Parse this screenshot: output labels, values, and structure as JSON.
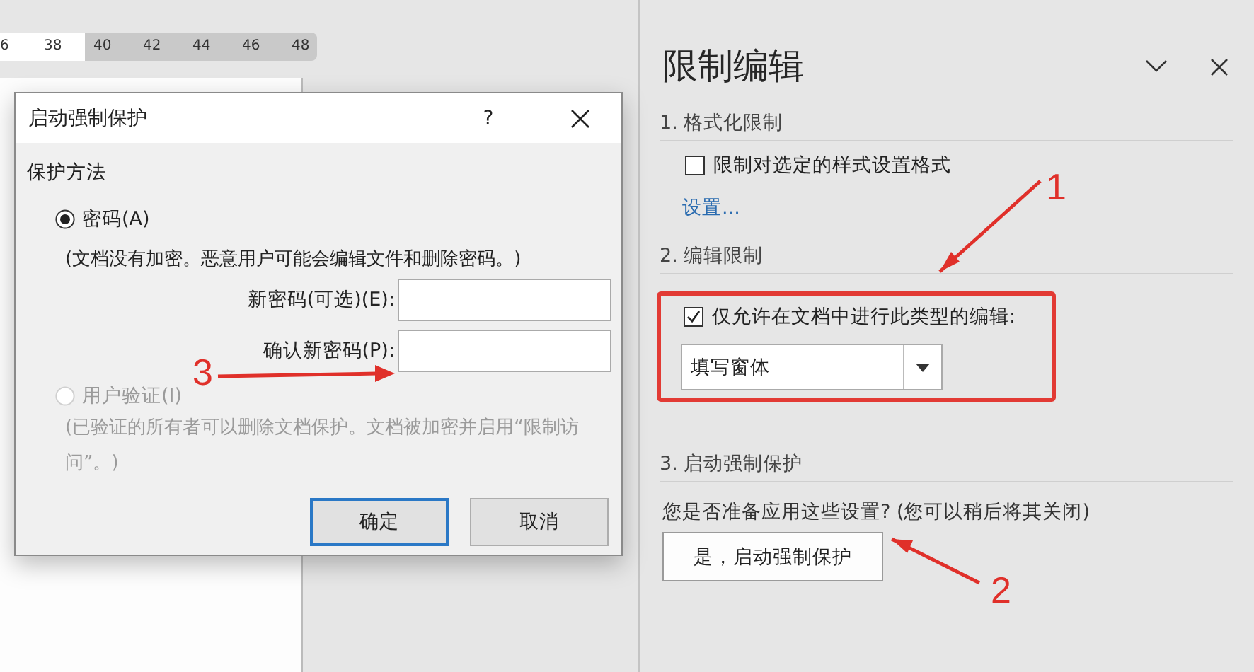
{
  "ruler": {
    "ticks": [
      "6",
      "38",
      "40",
      "42",
      "44",
      "46",
      "48"
    ]
  },
  "dialog": {
    "title": "启动强制保护",
    "help": "?",
    "section": "保护方法",
    "options": [
      {
        "label": "密码(A)",
        "selected": true,
        "disabled": false,
        "note": "(文档没有加密。恶意用户可能会编辑文件和删除密码。)"
      },
      {
        "label": "用户验证(I)",
        "selected": false,
        "disabled": true,
        "note": "(已验证的所有者可以删除文档保护。文档被加密并启用“限制访问”。)"
      }
    ],
    "fields": [
      {
        "label": "新密码(可选)(E):"
      },
      {
        "label": "确认新密码(P):"
      }
    ],
    "buttons": [
      {
        "label": "确定",
        "default": true
      },
      {
        "label": "取消",
        "default": false
      }
    ]
  },
  "pane": {
    "title": "限制编辑",
    "formatting": {
      "heading": "1. 格式化限制",
      "checkbox": {
        "label": "限制对选定的样式设置格式",
        "checked": false
      },
      "link": "设置..."
    },
    "editing": {
      "heading": "2. 编辑限制",
      "highlighted": true,
      "checkbox": {
        "label": "仅允许在文档中进行此类型的编辑:",
        "checked": true
      },
      "dropdown": {
        "value": "填写窗体"
      }
    },
    "enforcement": {
      "heading": "3. 启动强制保护",
      "prompt": "您是否准备应用这些设置? (您可以稍后将其关闭)",
      "button": "是，启动强制保护"
    }
  },
  "annotations": [
    {
      "label": "1"
    },
    {
      "label": "2"
    },
    {
      "label": "3"
    }
  ]
}
